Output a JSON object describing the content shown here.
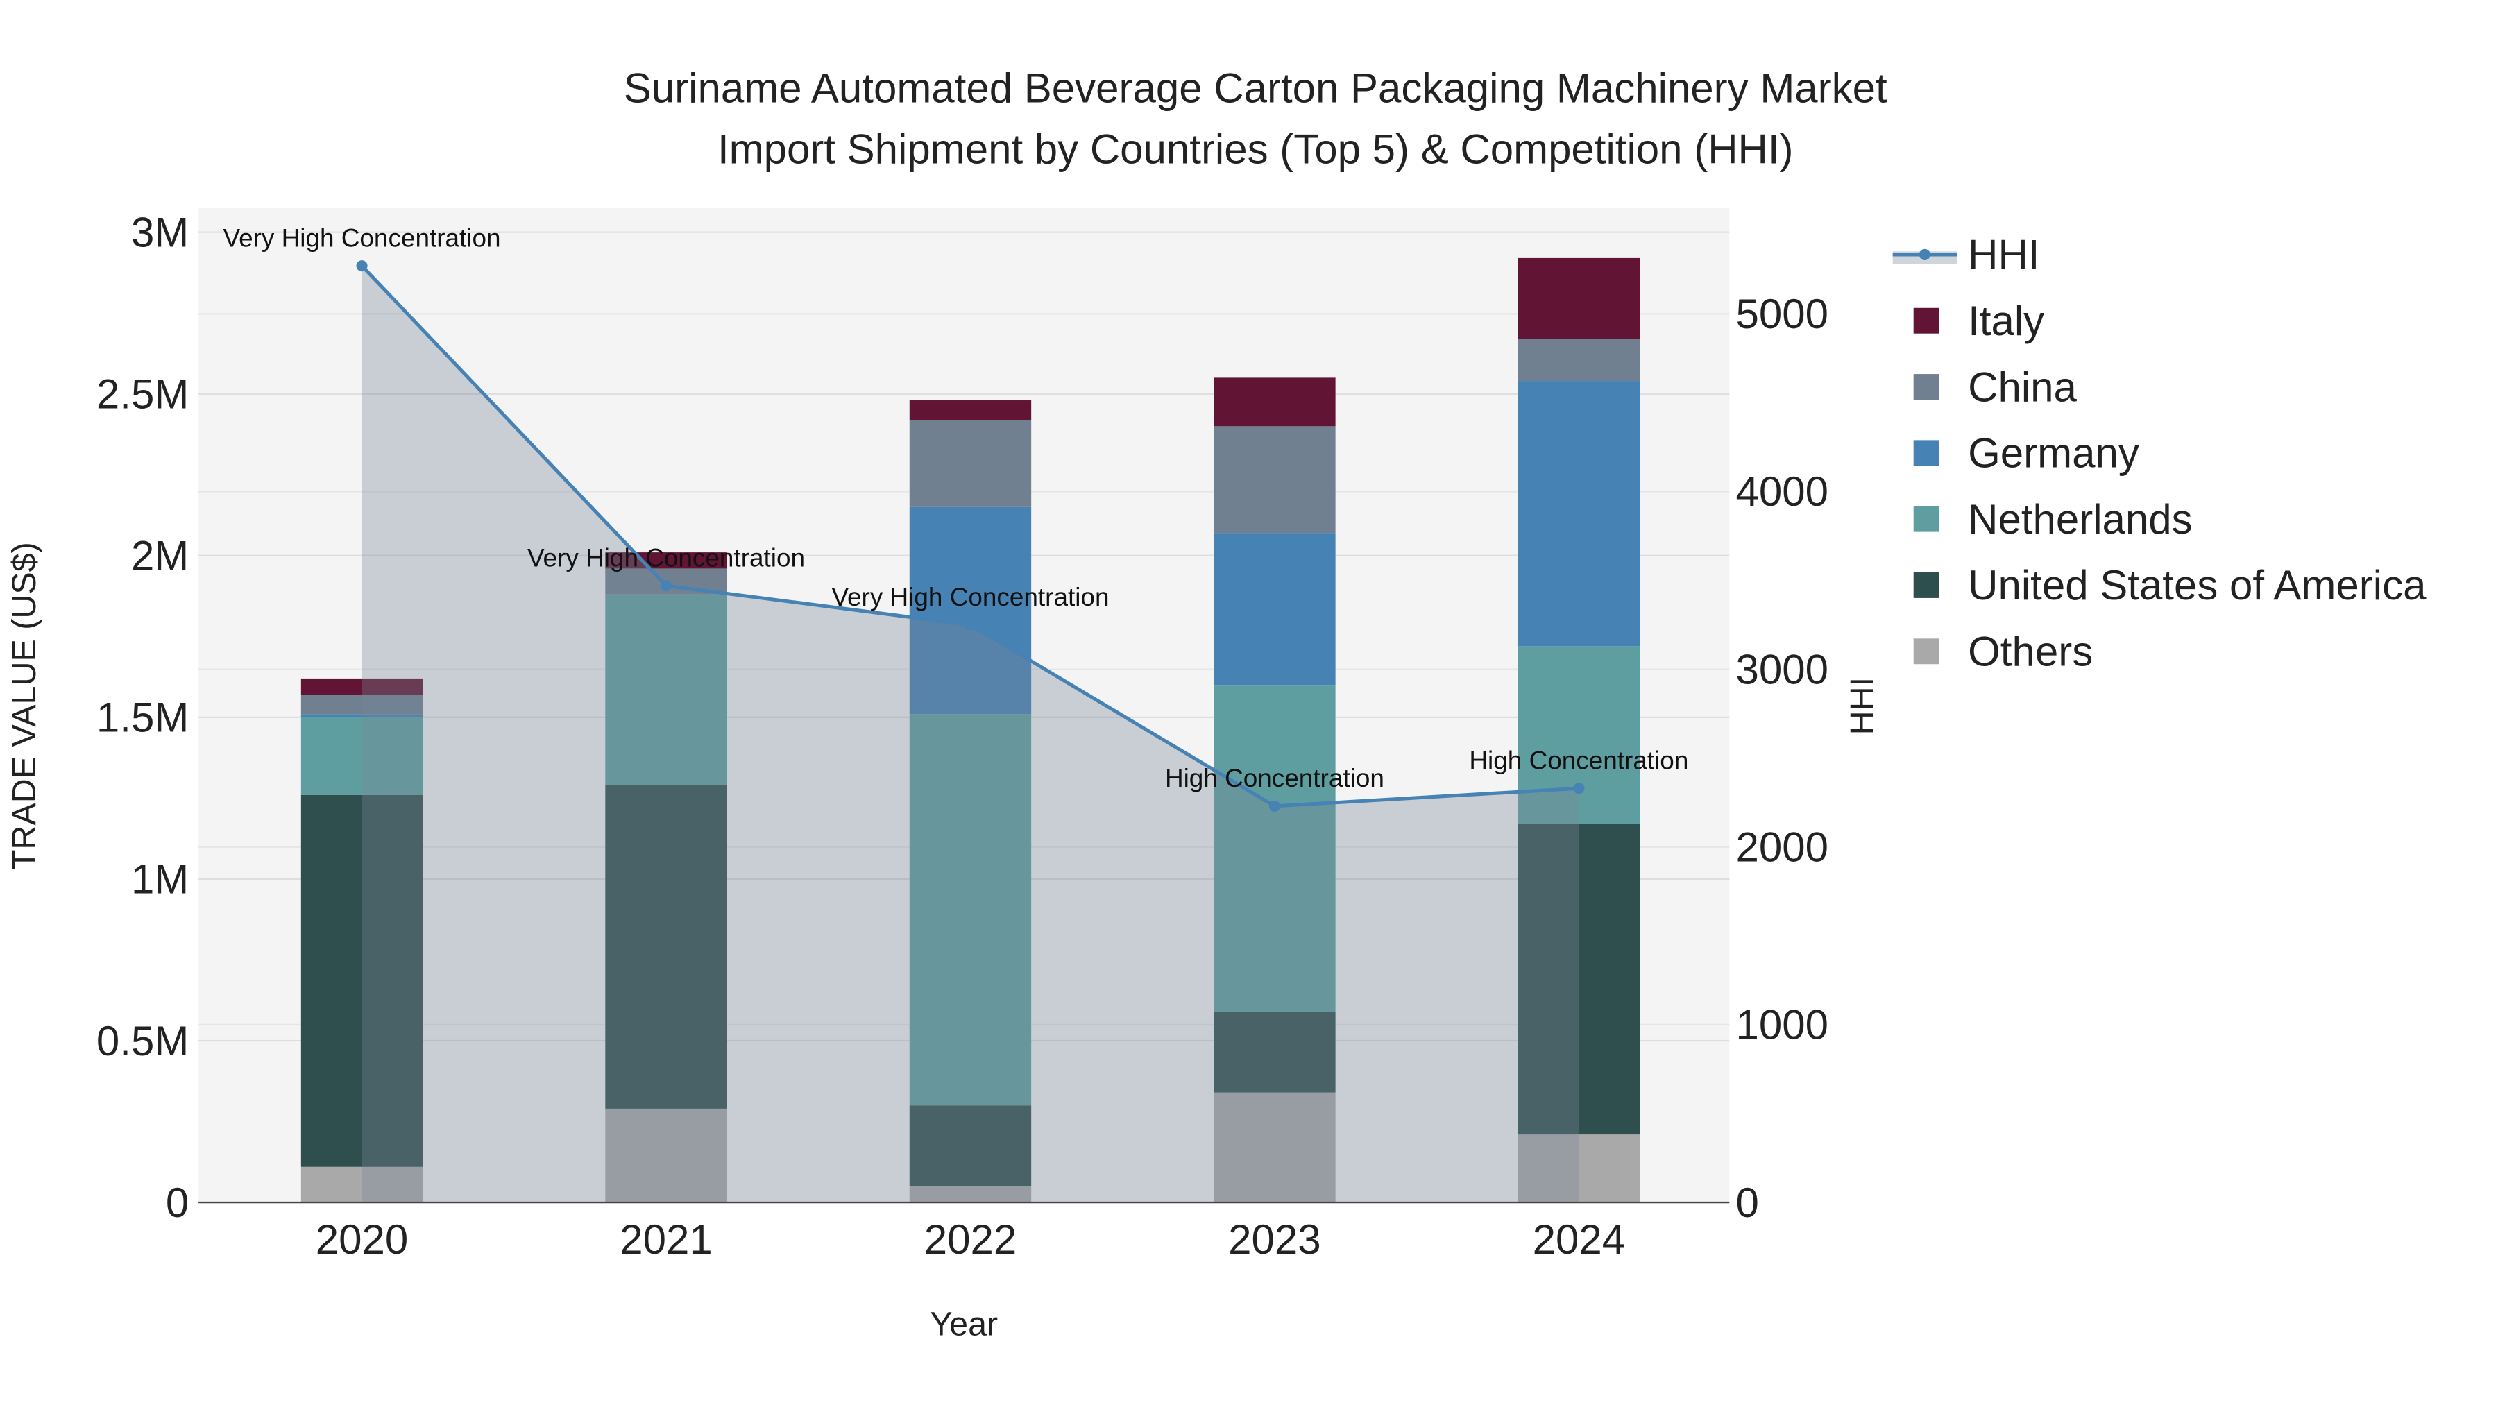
{
  "chart_data": {
    "type": "bar",
    "title_line1": "Suriname Automated Beverage Carton Packaging Machinery Market",
    "title_line2": "Import Shipment by Countries (Top 5) & Competition (HHI)",
    "xlabel": "Year",
    "ylabel": "TRADE VALUE (US$)",
    "y2label": "HHI",
    "categories": [
      "2020",
      "2021",
      "2022",
      "2023",
      "2024"
    ],
    "ylim": [
      0,
      3000000
    ],
    "y_ticks": [
      0,
      500000,
      1000000,
      1500000,
      2000000,
      2500000,
      3000000
    ],
    "y_tick_labels": [
      "0",
      "0.5M",
      "1M",
      "1.5M",
      "2M",
      "2.5M",
      "3M"
    ],
    "y2lim": [
      0,
      5600
    ],
    "y2_ticks": [
      0,
      1000,
      2000,
      3000,
      4000,
      5000
    ],
    "y2_tick_labels": [
      "0",
      "1000",
      "2000",
      "3000",
      "4000",
      "5000"
    ],
    "grid": true,
    "legend_position": "right",
    "series": [
      {
        "name": "Others",
        "color": "#a9a9a9",
        "values": [
          110000,
          290000,
          50000,
          340000,
          210000
        ]
      },
      {
        "name": "United States of America",
        "color": "#2f4f4f",
        "values": [
          1150000,
          1000000,
          250000,
          250000,
          960000
        ]
      },
      {
        "name": "Netherlands",
        "color": "#5f9ea0",
        "values": [
          240000,
          590000,
          1210000,
          1010000,
          550000
        ]
      },
      {
        "name": "Germany",
        "color": "#4682b4",
        "values": [
          10000,
          0,
          640000,
          470000,
          820000
        ]
      },
      {
        "name": "China",
        "color": "#708090",
        "values": [
          60000,
          80000,
          270000,
          330000,
          130000
        ]
      },
      {
        "name": "Italy",
        "color": "#611434",
        "values": [
          50000,
          50000,
          60000,
          150000,
          250000
        ]
      }
    ],
    "legend_order": [
      "HHI",
      "Italy",
      "China",
      "Germany",
      "Netherlands",
      "United States of America",
      "Others"
    ],
    "hhi": {
      "name": "HHI",
      "color": "#4682b4",
      "values": [
        5270,
        3470,
        3250,
        2230,
        2330
      ],
      "annotations": [
        "Very High Concentration",
        "Very High Concentration",
        "Very High Concentration",
        "High Concentration",
        "High Concentration"
      ]
    }
  }
}
